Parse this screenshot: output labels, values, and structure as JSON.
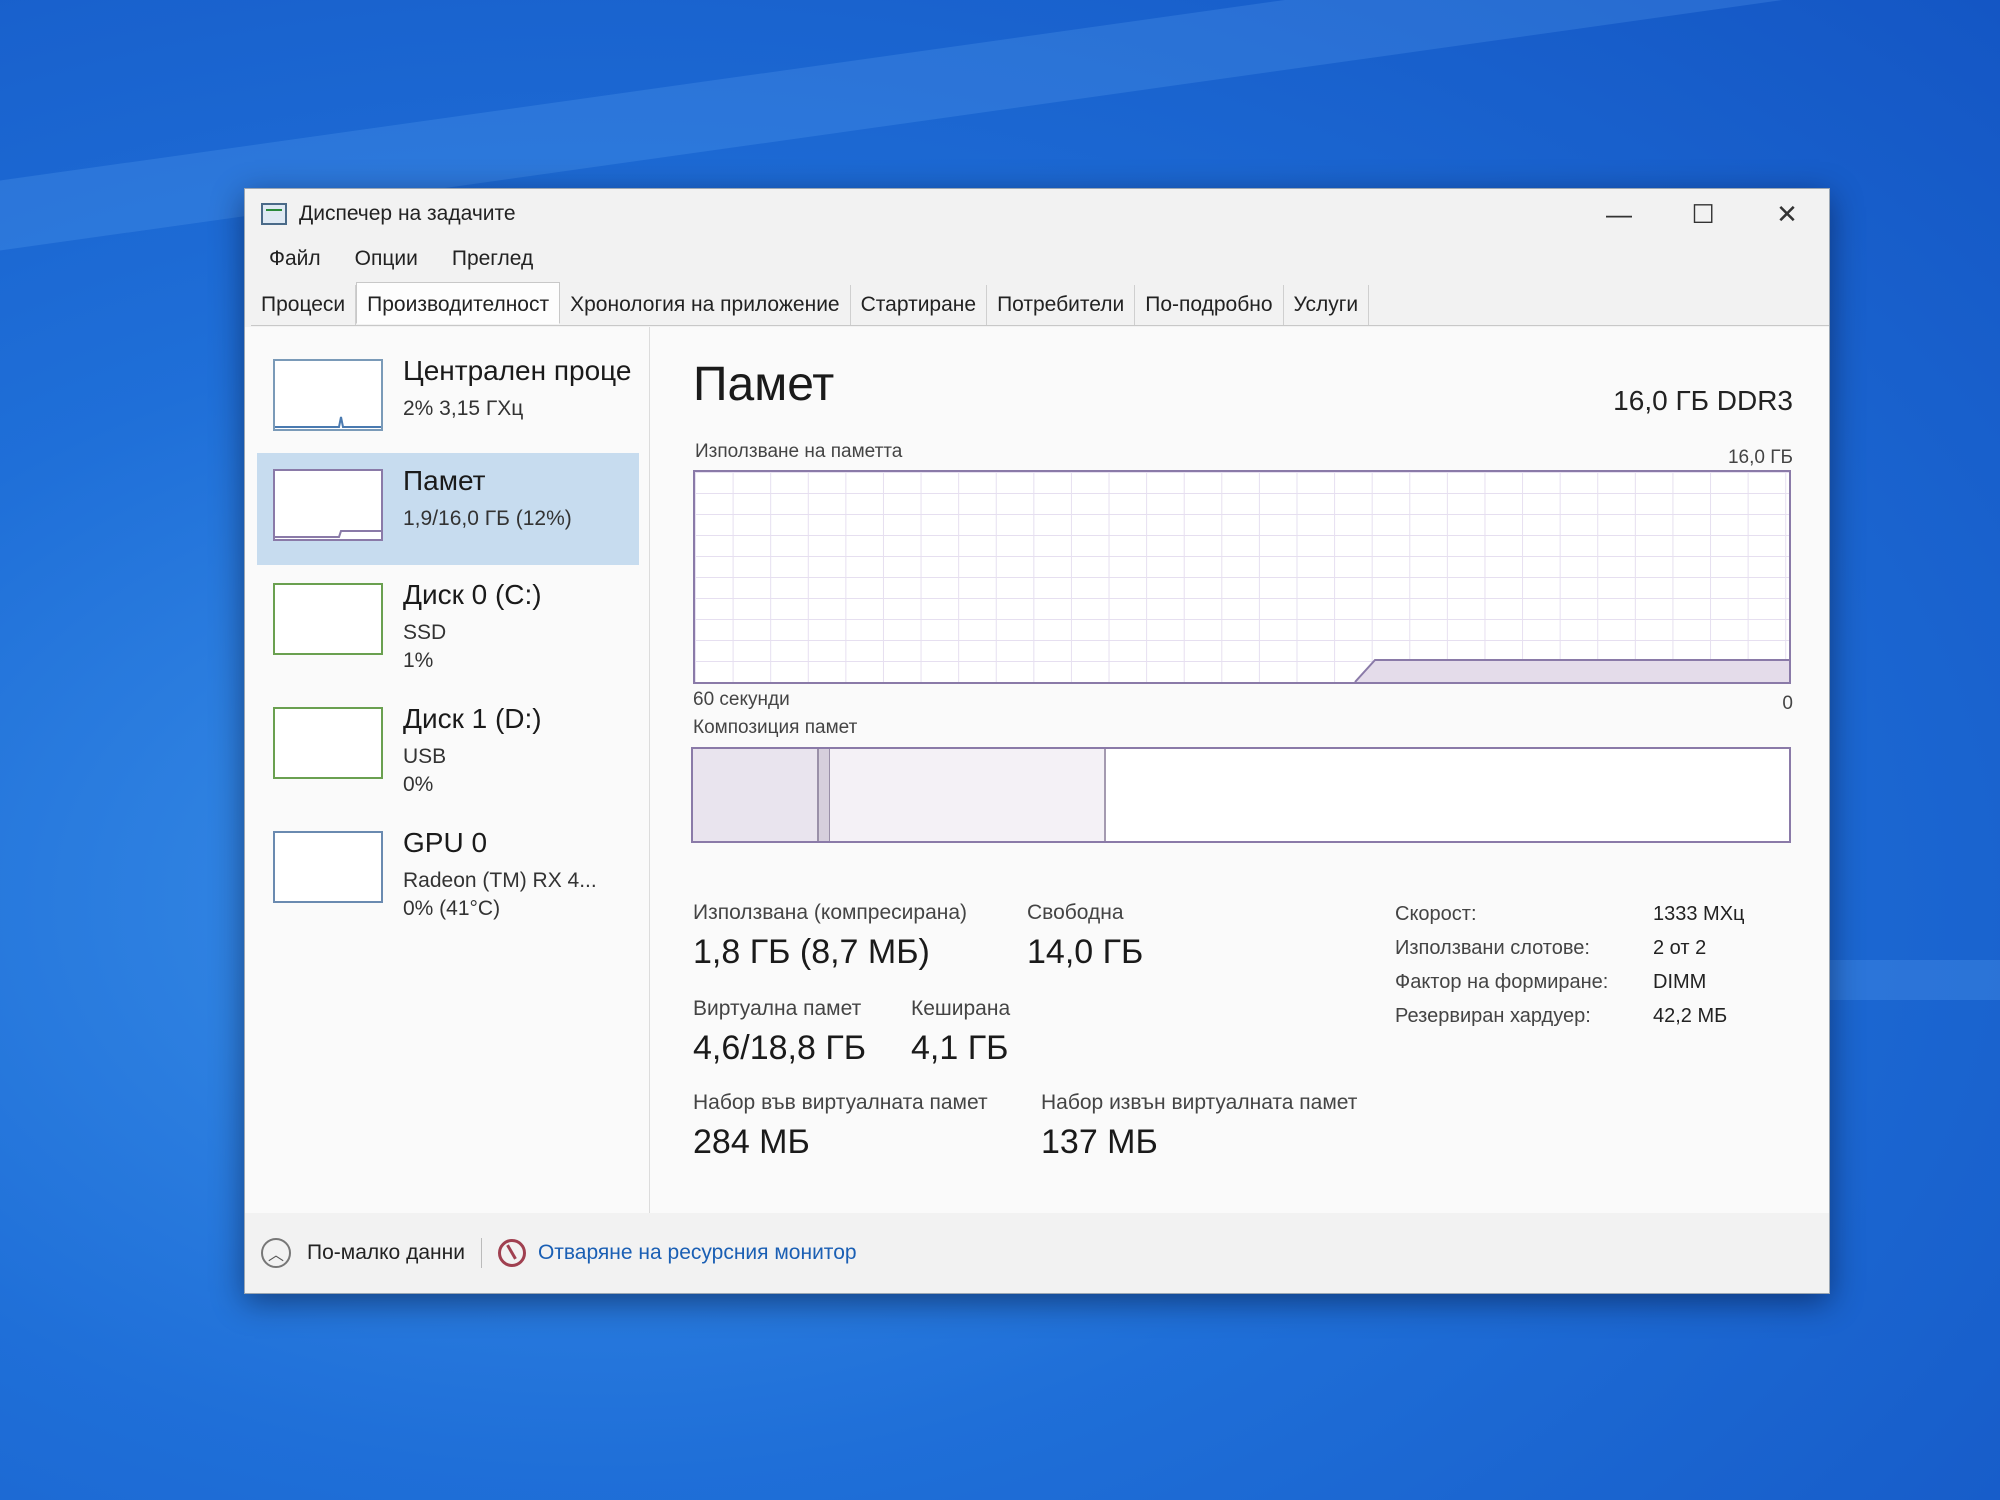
{
  "window": {
    "title": "Диспечер на задачите",
    "controls": {
      "minimize": "—",
      "maximize": "☐",
      "close": "✕"
    }
  },
  "menu": [
    "Файл",
    "Опции",
    "Преглед"
  ],
  "tabs": [
    {
      "label": "Процеси",
      "active": false
    },
    {
      "label": "Производителност",
      "active": true
    },
    {
      "label": "Хронология на приложение",
      "active": false
    },
    {
      "label": "Стартиране",
      "active": false
    },
    {
      "label": "Потребители",
      "active": false
    },
    {
      "label": "По-подробно",
      "active": false
    },
    {
      "label": "Услуги",
      "active": false
    }
  ],
  "sidebar": {
    "items": [
      {
        "name": "Централен проце",
        "line1": "2% 3,15 ГХц",
        "line2": ""
      },
      {
        "name": "Памет",
        "line1": "1,9/16,0 ГБ (12%)",
        "line2": ""
      },
      {
        "name": "Диск 0 (C:)",
        "line1": "SSD",
        "line2": "1%"
      },
      {
        "name": "Диск 1 (D:)",
        "line1": "USB",
        "line2": "0%"
      },
      {
        "name": "GPU 0",
        "line1": "Radeon (TM) RX 4...",
        "line2": "0% (41°C)"
      }
    ],
    "selected_index": 1
  },
  "main": {
    "title": "Памет",
    "spec": "16,0 ГБ DDR3",
    "usage_label": "Използване на паметта",
    "usage_max": "16,0 ГБ",
    "time_label": "60 секунди",
    "zero_label": "0",
    "composition_label": "Композиция памет",
    "stats": {
      "used_label": "Използвана (компресирана)",
      "used_value": "1,8 ГБ (8,7 МБ)",
      "free_label": "Свободна",
      "free_value": "14,0 ГБ",
      "virtual_label": "Виртуална памет",
      "virtual_value": "4,6/18,8 ГБ",
      "cached_label": "Кеширана",
      "cached_value": "4,1 ГБ",
      "paged_label": "Набор във виртуалната памет",
      "paged_value": "284 МБ",
      "nonpaged_label": "Набор извън виртуалната памет",
      "nonpaged_value": "137 МБ"
    },
    "details": [
      {
        "key": "Скорост:",
        "value": "1333 МХц"
      },
      {
        "key": "Използвани слотове:",
        "value": "2 от 2"
      },
      {
        "key": "Фактор на формиране:",
        "value": "DIMM"
      },
      {
        "key": "Резервиран хардуер:",
        "value": "42,2 МБ"
      }
    ]
  },
  "footer": {
    "fewer_details": "По-малко данни",
    "resource_monitor": "Отваряне на ресурсния монитор"
  },
  "colors": {
    "desktop": "#1f6fd8",
    "selected_item": "#c7dcef",
    "memory_accent": "#8a7aa8",
    "link": "#1a5fb4"
  }
}
